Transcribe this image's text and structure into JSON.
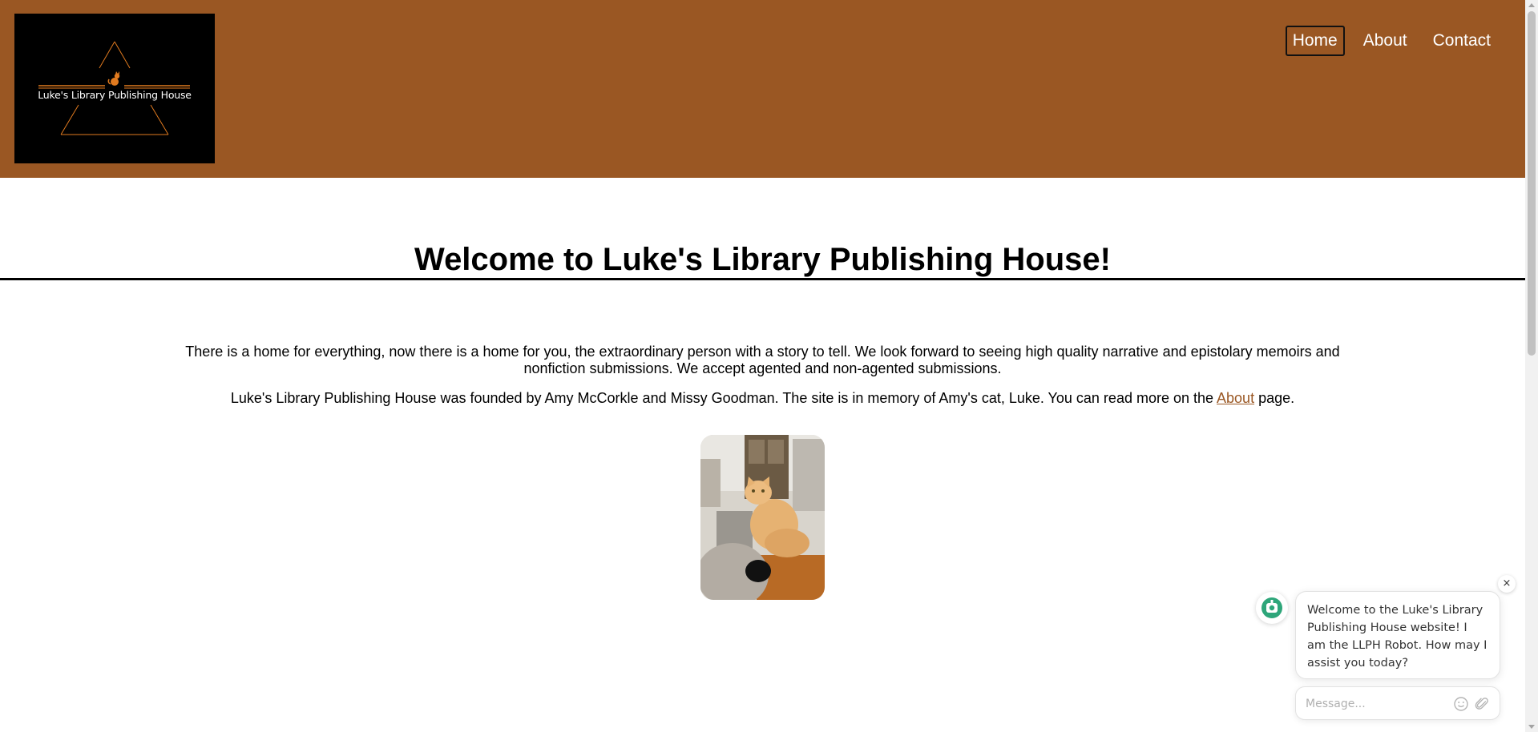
{
  "brand": {
    "logo_text": "Luke's Library Publishing House",
    "colors": {
      "header_bg": "#9a5723",
      "accent": "#e07a1f",
      "link": "#9a5723"
    }
  },
  "nav": {
    "items": [
      {
        "label": "Home",
        "active": true
      },
      {
        "label": "About",
        "active": false
      },
      {
        "label": "Contact",
        "active": false
      }
    ]
  },
  "main": {
    "title": "Welcome to Luke's Library Publishing House!",
    "paragraph1": "There is a home for everything, now there is a home for you, the extraordinary person with a story to tell. We look forward to seeing high quality narrative and epistolary memoirs and nonfiction submissions. We accept agented and non-agented submissions.",
    "paragraph2_before": "Luke's Library Publishing House was founded by Amy McCorkle and Missy Goodman. The site is in memory of Amy's cat, Luke. You can read more on the ",
    "paragraph2_link": "About",
    "paragraph2_after": " page.",
    "photo_icon": "orange-cat-photo"
  },
  "chat": {
    "avatar_icon": "robot-icon",
    "close_label": "×",
    "welcome_message": "Welcome to the Luke's Library Publishing House website! I am the LLPH Robot. How may I assist you today?",
    "input_placeholder": "Message...",
    "emoji_icon": "smiley-icon",
    "attach_icon": "paperclip-icon"
  }
}
